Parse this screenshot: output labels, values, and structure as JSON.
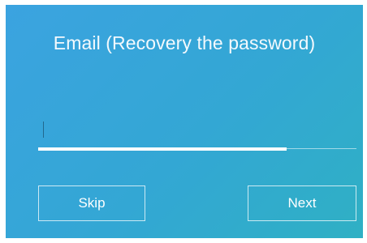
{
  "form": {
    "title": "Email (Recovery the password)",
    "email_value": "",
    "email_placeholder": "",
    "progress": 0.78,
    "skip_label": "Skip",
    "next_label": "Next"
  },
  "colors": {
    "gradient_start": "#3ba3e0",
    "gradient_end": "#2fb0c4",
    "text": "#ffffff",
    "progress_fill": "#ffffff"
  }
}
